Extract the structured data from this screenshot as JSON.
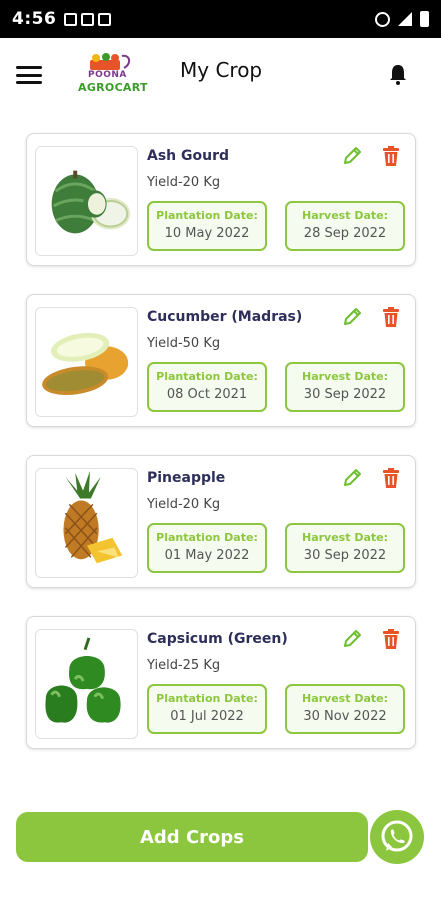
{
  "status": {
    "time": "4:56"
  },
  "header": {
    "title": "My Crop",
    "logo_line1": "POONA",
    "logo_line2": "AGROCART"
  },
  "crops": [
    {
      "name": "Ash Gourd",
      "yield": "Yield-20 Kg",
      "plantation_label": "Plantation Date:",
      "plantation_date": "10 May 2022",
      "harvest_label": "Harvest Date:",
      "harvest_date": "28 Sep 2022",
      "image": "ash-gourd"
    },
    {
      "name": "Cucumber (Madras)",
      "yield": "Yield-50 Kg",
      "plantation_label": "Plantation Date:",
      "plantation_date": "08 Oct 2021",
      "harvest_label": "Harvest Date:",
      "harvest_date": "30 Sep 2022",
      "image": "cucumber"
    },
    {
      "name": "Pineapple",
      "yield": "Yield-20 Kg",
      "plantation_label": "Plantation Date:",
      "plantation_date": "01 May 2022",
      "harvest_label": "Harvest Date:",
      "harvest_date": "30 Sep 2022",
      "image": "pineapple"
    },
    {
      "name": "Capsicum (Green)",
      "yield": "Yield-25 Kg",
      "plantation_label": "Plantation Date:",
      "plantation_date": "01 Jul 2022",
      "harvest_label": "Harvest Date:",
      "harvest_date": "30 Nov 2022",
      "image": "capsicum"
    }
  ],
  "actions": {
    "add_crops": "Add Crops"
  },
  "colors": {
    "accent": "#8cc63e",
    "delete": "#e8542a",
    "title": "#2d2f5a"
  },
  "icons": [
    "menu-icon",
    "bell-icon",
    "edit-icon",
    "delete-icon",
    "whatsapp-icon"
  ]
}
